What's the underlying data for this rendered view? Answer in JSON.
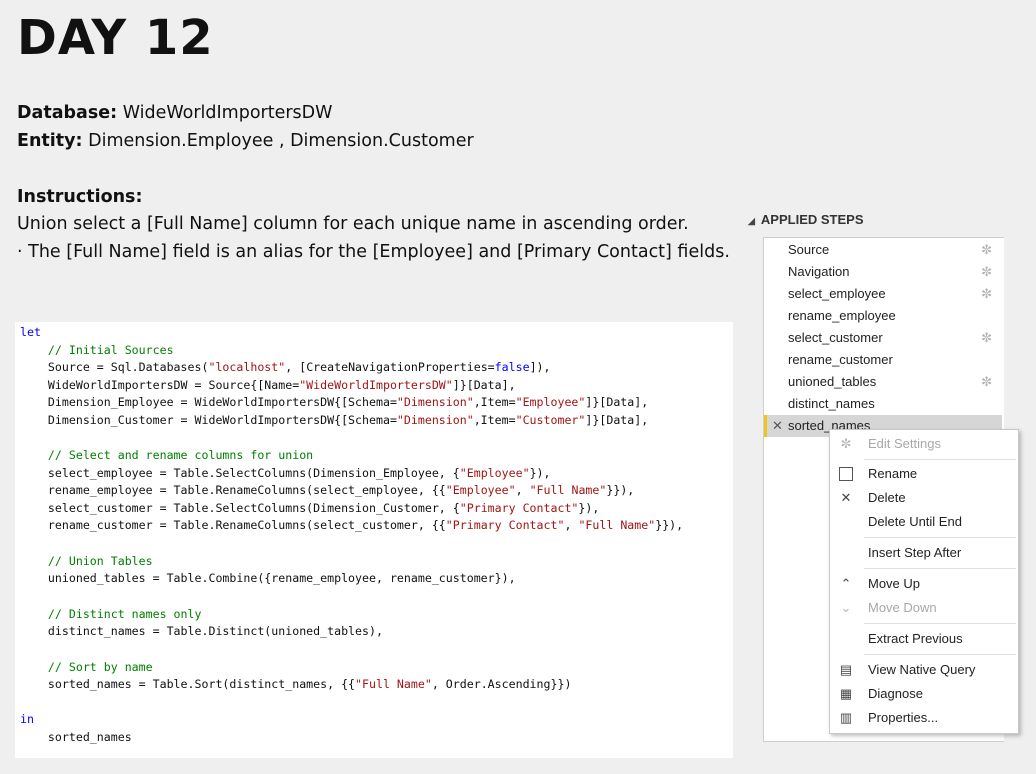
{
  "title": "DAY 12",
  "database": {
    "label": "Database:",
    "value": " WideWorldImportersDW"
  },
  "entity": {
    "label": "Entity:",
    "value": " Dimension.Employee , Dimension.Customer"
  },
  "instructions": {
    "heading": "Instructions:",
    "line1": "Union select a [Full Name] column for each unique name in ascending order.",
    "line2": "·  The [Full Name] field is an alias for the [Employee] and [Primary Contact] fields."
  },
  "code": {
    "l1": "let",
    "l2": "    // Initial Sources",
    "l3a": "    Source = Sql.Databases(",
    "l3b": "\"localhost\"",
    "l3c": ", [CreateNavigationProperties=",
    "l3d": "false",
    "l3e": "]),",
    "l4a": "    WideWorldImportersDW = Source{[Name=",
    "l4b": "\"WideWorldImportersDW\"",
    "l4c": "]}[Data],",
    "l5a": "    Dimension_Employee = WideWorldImportersDW{[Schema=",
    "l5b": "\"Dimension\"",
    "l5c": ",Item=",
    "l5d": "\"Employee\"",
    "l5e": "]}[Data],",
    "l6a": "    Dimension_Customer = WideWorldImportersDW{[Schema=",
    "l6b": "\"Dimension\"",
    "l6c": ",Item=",
    "l6d": "\"Customer\"",
    "l6e": "]}[Data],",
    "l7": "    // Select and rename columns for union",
    "l8a": "    select_employee = Table.SelectColumns(Dimension_Employee, {",
    "l8b": "\"Employee\"",
    "l8c": "}),",
    "l9a": "    rename_employee = Table.RenameColumns(select_employee, {{",
    "l9b": "\"Employee\"",
    "l9c": ", ",
    "l9d": "\"Full Name\"",
    "l9e": "}}),",
    "l10a": "    select_customer = Table.SelectColumns(Dimension_Customer, {",
    "l10b": "\"Primary Contact\"",
    "l10c": "}),",
    "l11a": "    rename_customer = Table.RenameColumns(select_customer, {{",
    "l11b": "\"Primary Contact\"",
    "l11c": ", ",
    "l11d": "\"Full Name\"",
    "l11e": "}}),",
    "l12": "    // Union Tables",
    "l13": "    unioned_tables = Table.Combine({rename_employee, rename_customer}),",
    "l14": "    // Distinct names only",
    "l15": "    distinct_names = Table.Distinct(unioned_tables),",
    "l16": "    // Sort by name",
    "l17a": "    sorted_names = Table.Sort(distinct_names, {{",
    "l17b": "\"Full Name\"",
    "l17c": ", Order.Ascending}})",
    "l18": "in",
    "l19": "    sorted_names"
  },
  "applied_steps": {
    "heading": "APPLIED STEPS",
    "items": [
      {
        "label": "Source",
        "gear": true
      },
      {
        "label": "Navigation",
        "gear": true
      },
      {
        "label": "select_employee",
        "gear": true
      },
      {
        "label": "rename_employee",
        "gear": false
      },
      {
        "label": "select_customer",
        "gear": true
      },
      {
        "label": "rename_customer",
        "gear": false
      },
      {
        "label": "unioned_tables",
        "gear": true
      },
      {
        "label": "distinct_names",
        "gear": false
      },
      {
        "label": "sorted_names",
        "gear": false,
        "selected": true
      }
    ]
  },
  "context_menu": {
    "edit_settings": "Edit Settings",
    "rename": "Rename",
    "delete": "Delete",
    "delete_until_end": "Delete Until End",
    "insert_step_after": "Insert Step After",
    "move_up": "Move Up",
    "move_down": "Move Down",
    "extract_previous": "Extract Previous",
    "view_native_query": "View Native Query",
    "diagnose": "Diagnose",
    "properties": "Properties..."
  }
}
